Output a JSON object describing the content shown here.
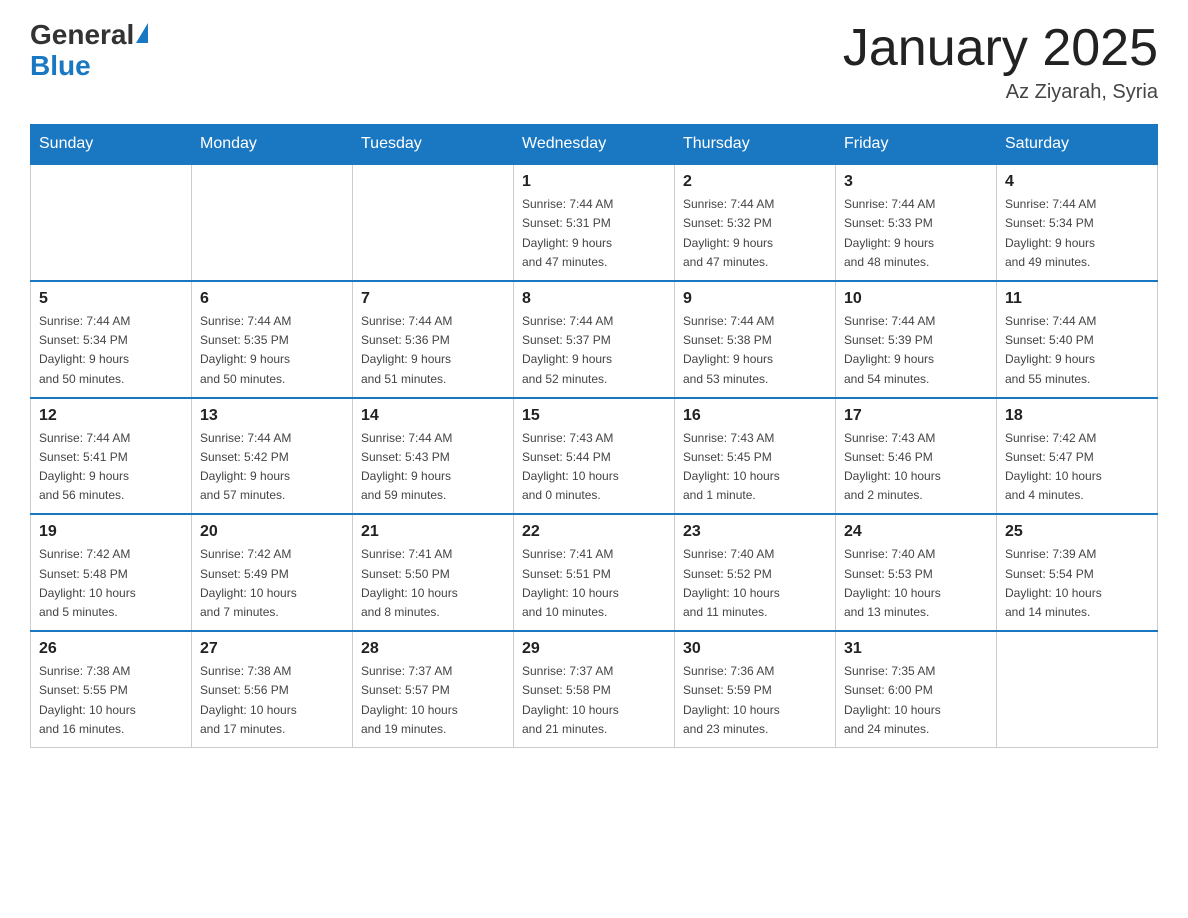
{
  "header": {
    "logo_general": "General",
    "logo_blue": "Blue",
    "title": "January 2025",
    "location": "Az Ziyarah, Syria"
  },
  "days_of_week": [
    "Sunday",
    "Monday",
    "Tuesday",
    "Wednesday",
    "Thursday",
    "Friday",
    "Saturday"
  ],
  "weeks": [
    [
      {
        "day": "",
        "info": ""
      },
      {
        "day": "",
        "info": ""
      },
      {
        "day": "",
        "info": ""
      },
      {
        "day": "1",
        "info": "Sunrise: 7:44 AM\nSunset: 5:31 PM\nDaylight: 9 hours\nand 47 minutes."
      },
      {
        "day": "2",
        "info": "Sunrise: 7:44 AM\nSunset: 5:32 PM\nDaylight: 9 hours\nand 47 minutes."
      },
      {
        "day": "3",
        "info": "Sunrise: 7:44 AM\nSunset: 5:33 PM\nDaylight: 9 hours\nand 48 minutes."
      },
      {
        "day": "4",
        "info": "Sunrise: 7:44 AM\nSunset: 5:34 PM\nDaylight: 9 hours\nand 49 minutes."
      }
    ],
    [
      {
        "day": "5",
        "info": "Sunrise: 7:44 AM\nSunset: 5:34 PM\nDaylight: 9 hours\nand 50 minutes."
      },
      {
        "day": "6",
        "info": "Sunrise: 7:44 AM\nSunset: 5:35 PM\nDaylight: 9 hours\nand 50 minutes."
      },
      {
        "day": "7",
        "info": "Sunrise: 7:44 AM\nSunset: 5:36 PM\nDaylight: 9 hours\nand 51 minutes."
      },
      {
        "day": "8",
        "info": "Sunrise: 7:44 AM\nSunset: 5:37 PM\nDaylight: 9 hours\nand 52 minutes."
      },
      {
        "day": "9",
        "info": "Sunrise: 7:44 AM\nSunset: 5:38 PM\nDaylight: 9 hours\nand 53 minutes."
      },
      {
        "day": "10",
        "info": "Sunrise: 7:44 AM\nSunset: 5:39 PM\nDaylight: 9 hours\nand 54 minutes."
      },
      {
        "day": "11",
        "info": "Sunrise: 7:44 AM\nSunset: 5:40 PM\nDaylight: 9 hours\nand 55 minutes."
      }
    ],
    [
      {
        "day": "12",
        "info": "Sunrise: 7:44 AM\nSunset: 5:41 PM\nDaylight: 9 hours\nand 56 minutes."
      },
      {
        "day": "13",
        "info": "Sunrise: 7:44 AM\nSunset: 5:42 PM\nDaylight: 9 hours\nand 57 minutes."
      },
      {
        "day": "14",
        "info": "Sunrise: 7:44 AM\nSunset: 5:43 PM\nDaylight: 9 hours\nand 59 minutes."
      },
      {
        "day": "15",
        "info": "Sunrise: 7:43 AM\nSunset: 5:44 PM\nDaylight: 10 hours\nand 0 minutes."
      },
      {
        "day": "16",
        "info": "Sunrise: 7:43 AM\nSunset: 5:45 PM\nDaylight: 10 hours\nand 1 minute."
      },
      {
        "day": "17",
        "info": "Sunrise: 7:43 AM\nSunset: 5:46 PM\nDaylight: 10 hours\nand 2 minutes."
      },
      {
        "day": "18",
        "info": "Sunrise: 7:42 AM\nSunset: 5:47 PM\nDaylight: 10 hours\nand 4 minutes."
      }
    ],
    [
      {
        "day": "19",
        "info": "Sunrise: 7:42 AM\nSunset: 5:48 PM\nDaylight: 10 hours\nand 5 minutes."
      },
      {
        "day": "20",
        "info": "Sunrise: 7:42 AM\nSunset: 5:49 PM\nDaylight: 10 hours\nand 7 minutes."
      },
      {
        "day": "21",
        "info": "Sunrise: 7:41 AM\nSunset: 5:50 PM\nDaylight: 10 hours\nand 8 minutes."
      },
      {
        "day": "22",
        "info": "Sunrise: 7:41 AM\nSunset: 5:51 PM\nDaylight: 10 hours\nand 10 minutes."
      },
      {
        "day": "23",
        "info": "Sunrise: 7:40 AM\nSunset: 5:52 PM\nDaylight: 10 hours\nand 11 minutes."
      },
      {
        "day": "24",
        "info": "Sunrise: 7:40 AM\nSunset: 5:53 PM\nDaylight: 10 hours\nand 13 minutes."
      },
      {
        "day": "25",
        "info": "Sunrise: 7:39 AM\nSunset: 5:54 PM\nDaylight: 10 hours\nand 14 minutes."
      }
    ],
    [
      {
        "day": "26",
        "info": "Sunrise: 7:38 AM\nSunset: 5:55 PM\nDaylight: 10 hours\nand 16 minutes."
      },
      {
        "day": "27",
        "info": "Sunrise: 7:38 AM\nSunset: 5:56 PM\nDaylight: 10 hours\nand 17 minutes."
      },
      {
        "day": "28",
        "info": "Sunrise: 7:37 AM\nSunset: 5:57 PM\nDaylight: 10 hours\nand 19 minutes."
      },
      {
        "day": "29",
        "info": "Sunrise: 7:37 AM\nSunset: 5:58 PM\nDaylight: 10 hours\nand 21 minutes."
      },
      {
        "day": "30",
        "info": "Sunrise: 7:36 AM\nSunset: 5:59 PM\nDaylight: 10 hours\nand 23 minutes."
      },
      {
        "day": "31",
        "info": "Sunrise: 7:35 AM\nSunset: 6:00 PM\nDaylight: 10 hours\nand 24 minutes."
      },
      {
        "day": "",
        "info": ""
      }
    ]
  ]
}
